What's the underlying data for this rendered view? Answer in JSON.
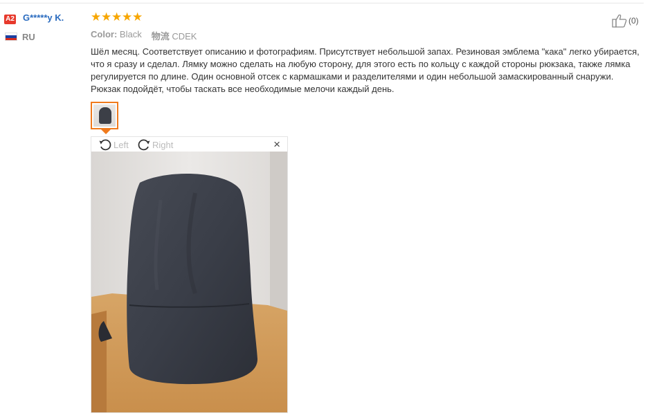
{
  "reviewer": {
    "level_badge": "A2",
    "name": "G*****y K.",
    "country": "RU",
    "flag_colors": [
      "#ffffff",
      "#1b3fa0",
      "#d52b1e"
    ]
  },
  "rating": {
    "stars": 5,
    "max": 5,
    "color": "#f7a600"
  },
  "attributes": {
    "color_label": "Color:",
    "color_value": "Black",
    "shipping_label": "物流",
    "shipping_value": "CDEK"
  },
  "review_text": "Шёл месяц. Соответствует описанию и фотографиям. Присутствует небольшой запах. Резиновая эмблема \"кака\" легко убирается, что я сразу и сделал. Лямку можно сделать на любую сторону, для этого есть по кольцу с каждой стороны рюкзака, также лямка регулируется по длине. Один основной отсек с кармашками и разделителями и один небольшой замаскированный снаружи. Рюкзак подойдёт, чтобы таскать все необходимые мелочи каждый день.",
  "viewer": {
    "rotate_left_label": "Left",
    "rotate_right_label": "Right",
    "close_icon": "×"
  },
  "helpful": {
    "count_text": "(0)"
  },
  "colors": {
    "accent": "#f07a1c",
    "link": "#2a6bbf",
    "badge": "#e7392c"
  }
}
